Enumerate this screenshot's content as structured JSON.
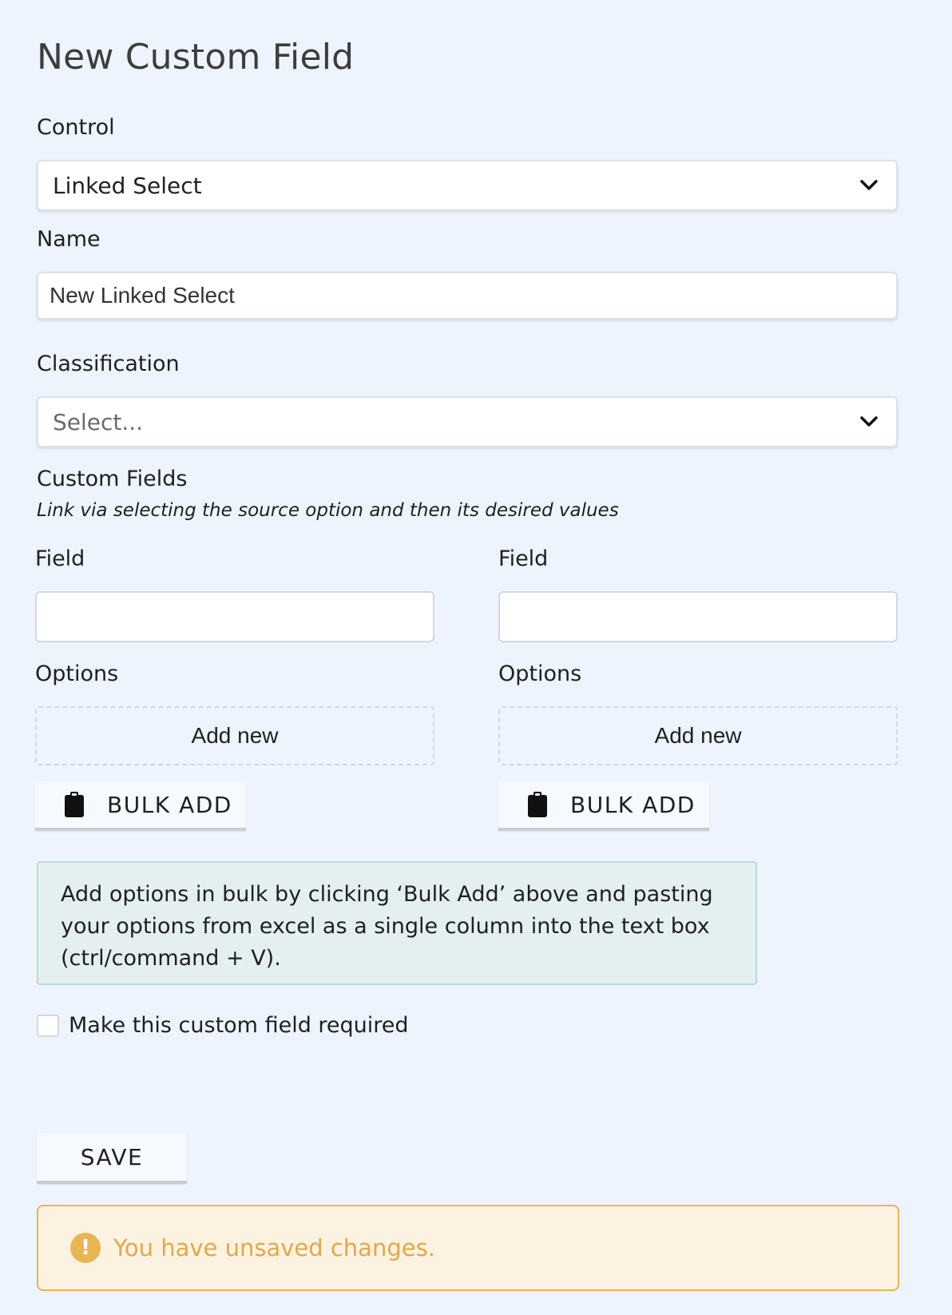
{
  "page": {
    "title": "New Custom Field"
  },
  "control": {
    "label": "Control",
    "value": "Linked Select"
  },
  "name": {
    "label": "Name",
    "value": "New Linked Select"
  },
  "classification": {
    "label": "Classification",
    "placeholder": "Select..."
  },
  "custom_fields": {
    "heading": "Custom Fields",
    "hint": "Link via selecting the source option and then its desired values",
    "columns": [
      {
        "field_label": "Field",
        "field_value": "",
        "options_label": "Options",
        "add_new_label": "Add new",
        "bulk_add_label": "BULK ADD"
      },
      {
        "field_label": "Field",
        "field_value": "",
        "options_label": "Options",
        "add_new_label": "Add new",
        "bulk_add_label": "BULK ADD"
      }
    ]
  },
  "info": {
    "text": "Add options in bulk by clicking ‘Bulk Add’ above and pasting your options from excel as a single column into the text box (ctrl/command + V)."
  },
  "required": {
    "label": "Make this custom field required",
    "checked": false
  },
  "actions": {
    "save_label": "SAVE"
  },
  "warning": {
    "text": "You have unsaved changes.",
    "icon": "!",
    "color": "#e2a84a"
  },
  "icons": {
    "select_chevron": "chevron-down-icon",
    "bulk_add": "clipboard-icon",
    "warning": "exclamation-circle-icon"
  }
}
